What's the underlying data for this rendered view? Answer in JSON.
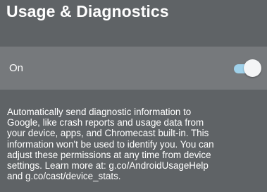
{
  "header": {
    "title": "Usage & Diagnostics"
  },
  "setting": {
    "label": "On",
    "toggle_state": "on",
    "toggle_track_color": "#9fd1ea",
    "toggle_thumb_color": "#f4f5f6"
  },
  "description": {
    "text": "Automatically send diagnostic information to\nGoogle, like crash reports and usage data from\nyour device, apps, and Chromecast built-in. This\ninformation won't be used to identify you. You can\nadjust these permissions at any time from device\nsettings. Learn more at: g.co/AndroidUsageHelp\nand g.co/cast/device_stats."
  },
  "colors": {
    "background": "#5f6366",
    "row_background": "#76797c",
    "text": "#ffffff"
  }
}
